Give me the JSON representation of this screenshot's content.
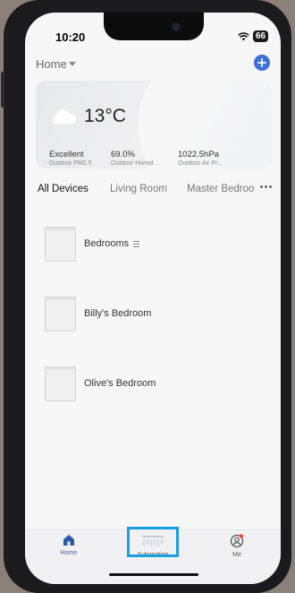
{
  "status_bar": {
    "time": "10:20",
    "battery": "66"
  },
  "header": {
    "home_label": "Home"
  },
  "weather": {
    "temperature": "13°C",
    "metrics": [
      {
        "value": "Excellent",
        "label": "Outdoor PM2.5"
      },
      {
        "value": "69.0%",
        "label": "Outdoor Humid..."
      },
      {
        "value": "1022.5hPa",
        "label": "Outdoor Air Pr..."
      }
    ]
  },
  "tabs": [
    "All Devices",
    "Living Room",
    "Master Bedroo"
  ],
  "devices": [
    {
      "name": "Bedrooms"
    },
    {
      "name": "Billy's Bedroom"
    },
    {
      "name": "Olive's Bedroom"
    }
  ],
  "nav": {
    "home": "Home",
    "automation": "Automation",
    "me": "Me"
  },
  "colors": {
    "accent": "#3f6fd9",
    "highlight": "#1a9fe0",
    "notification": "#e04a3a"
  }
}
